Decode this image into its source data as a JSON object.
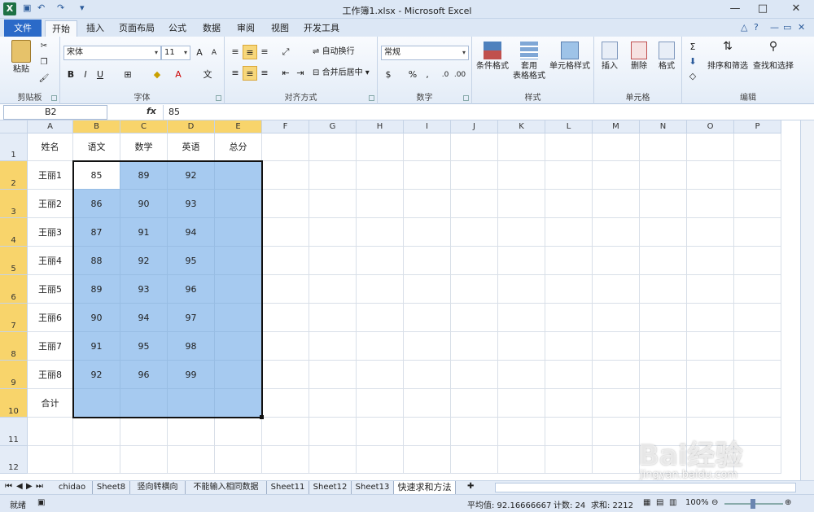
{
  "window": {
    "title": "工作簿1.xlsx - Microsoft Excel",
    "app_icon": "X"
  },
  "tabs": {
    "file": "文件",
    "items": [
      "开始",
      "插入",
      "页面布局",
      "公式",
      "数据",
      "审阅",
      "视图",
      "开发工具"
    ],
    "active": "开始"
  },
  "ribbon": {
    "clipboard": {
      "paste": "粘贴",
      "label": "剪贴板"
    },
    "font": {
      "name": "宋体",
      "size": "11",
      "label": "字体"
    },
    "alignment": {
      "wrap": "自动换行",
      "merge": "合并后居中",
      "label": "对齐方式"
    },
    "number": {
      "format": "常规",
      "label": "数字"
    },
    "styles": {
      "conditional": "条件格式",
      "table_line1": "套用",
      "table_line2": "表格格式",
      "cell_styles": "单元格样式",
      "label": "样式"
    },
    "cells": {
      "insert": "插入",
      "delete": "删除",
      "format": "格式",
      "label": "单元格"
    },
    "editing": {
      "sort": "排序和筛选",
      "find": "查找和选择",
      "label": "编辑"
    }
  },
  "formula_bar": {
    "name_box": "B2",
    "fx": "fx",
    "value": "85"
  },
  "columns": [
    "A",
    "B",
    "C",
    "D",
    "E",
    "F",
    "G",
    "H",
    "I",
    "J",
    "K",
    "L",
    "M",
    "N",
    "O",
    "P"
  ],
  "rows": [
    "1",
    "2",
    "3",
    "4",
    "5",
    "6",
    "7",
    "8",
    "9",
    "10",
    "11",
    "12"
  ],
  "header_row": [
    "姓名",
    "语文",
    "数学",
    "英语",
    "总分"
  ],
  "data_rows": [
    [
      "王丽1",
      "85",
      "89",
      "92",
      ""
    ],
    [
      "王丽2",
      "86",
      "90",
      "93",
      ""
    ],
    [
      "王丽3",
      "87",
      "91",
      "94",
      ""
    ],
    [
      "王丽4",
      "88",
      "92",
      "95",
      ""
    ],
    [
      "王丽5",
      "89",
      "93",
      "96",
      ""
    ],
    [
      "王丽6",
      "90",
      "94",
      "97",
      ""
    ],
    [
      "王丽7",
      "91",
      "95",
      "98",
      ""
    ],
    [
      "王丽8",
      "92",
      "96",
      "99",
      ""
    ],
    [
      "合计",
      "",
      "",
      "",
      ""
    ]
  ],
  "sheets": [
    "chidao",
    "Sheet8",
    "竖向转横向",
    "不能输入相同数据",
    "Sheet11",
    "Sheet12",
    "Sheet13",
    "快速求和方法"
  ],
  "active_sheet": "快速求和方法",
  "status": {
    "ready": "就绪",
    "average": "平均值: 92.16666667",
    "count": "计数: 24",
    "sum": "求和: 2212",
    "zoom": "100%"
  },
  "watermark": {
    "logo": "Bai经验",
    "url": "jingyan.baidu.com"
  }
}
